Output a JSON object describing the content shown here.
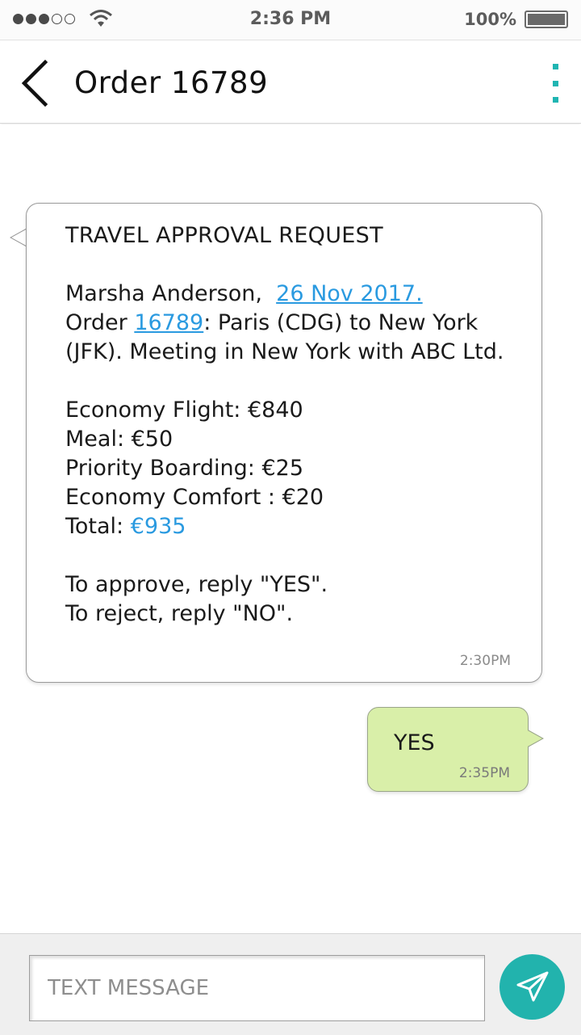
{
  "status_bar": {
    "time": "2:36 PM",
    "battery_percent": "100%",
    "signal_icon": "signal-dots-icon",
    "wifi_icon": "wifi-icon",
    "battery_icon": "battery-icon"
  },
  "header": {
    "title": "Order 16789",
    "back_icon": "chevron-left-icon",
    "menu_icon": "more-vertical-icon",
    "accent_color": "#1fb5b2"
  },
  "incoming_message": {
    "heading": "TRAVEL APPROVAL REQUEST",
    "requester_name": "Marsha Anderson,",
    "date_link": "26 Nov 2017.",
    "order_prefix": "Order",
    "order_link": "16789",
    "route_line_1": ": Paris (CDG) to New York",
    "route_line_2": "(JFK). Meeting in New York with ABC Ltd.",
    "items": [
      "Economy Flight: €840",
      "Meal: €50",
      "Priority Boarding: €25",
      "Economy Comfort : €20"
    ],
    "total_label": "Total:",
    "total_value": "€935",
    "approve_instruction": "To approve, reply \"YES\".",
    "reject_instruction": "To reject, reply \"NO\".",
    "time": "2:30PM",
    "link_color": "#2a9ae0"
  },
  "outgoing_message": {
    "text": "YES",
    "time": "2:35PM",
    "bubble_color": "#d9efa9"
  },
  "composer": {
    "placeholder": "TEXT MESSAGE",
    "value": "",
    "send_icon": "send-icon",
    "send_color": "#22b3ad"
  }
}
